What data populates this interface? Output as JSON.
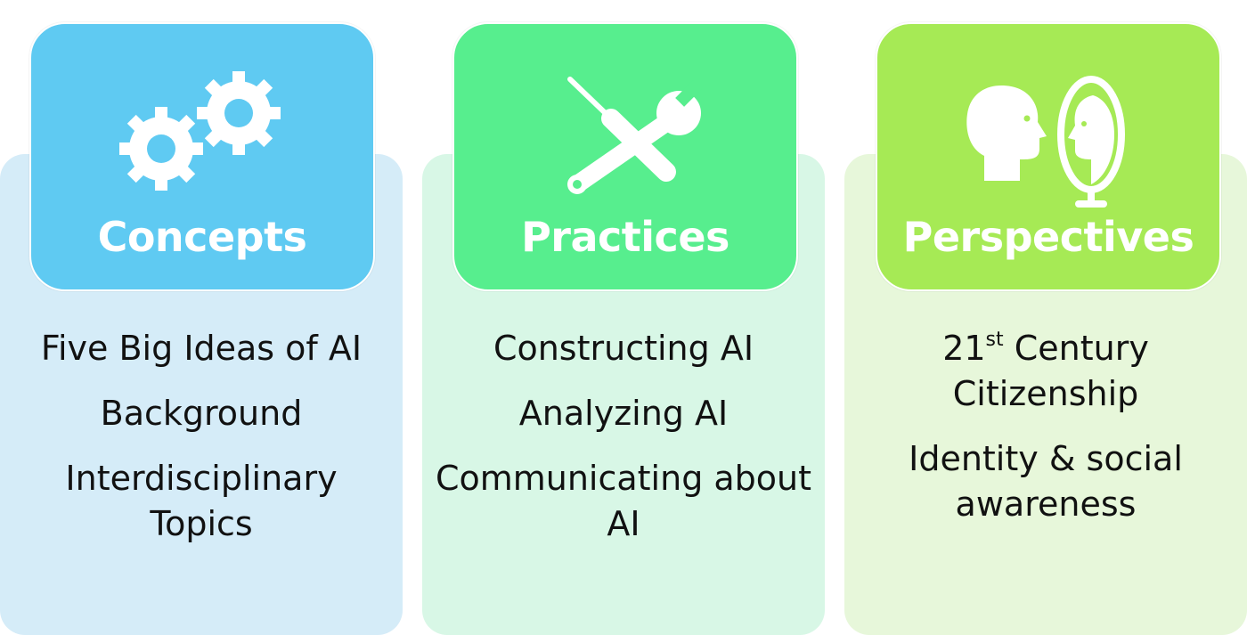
{
  "colors": {
    "concepts_header": "#5fcaf2",
    "concepts_bg": "#d5ecf8",
    "practices_header": "#57ee8e",
    "practices_bg": "#d8f7e6",
    "perspectives_header": "#a6ea55",
    "perspectives_bg": "#e7f7da"
  },
  "columns": [
    {
      "title": "Concepts",
      "icon": "gears-icon",
      "items": [
        {
          "lines": [
            "Five Big Ideas of AI"
          ]
        },
        {
          "lines": [
            "Background"
          ]
        },
        {
          "lines": [
            "Interdisciplinary",
            "Topics"
          ]
        }
      ]
    },
    {
      "title": "Practices",
      "icon": "tools-icon",
      "items": [
        {
          "lines": [
            "Constructing AI"
          ]
        },
        {
          "lines": [
            "Analyzing AI"
          ]
        },
        {
          "lines": [
            "Communicating about",
            "AI"
          ]
        }
      ]
    },
    {
      "title": "Perspectives",
      "icon": "mirror-head-icon",
      "items": [
        {
          "line1_num": "21",
          "line1_sup": "st",
          "line1_rest": " Century",
          "line2": "Citizenship"
        },
        {
          "lines": [
            "Identity & social",
            "awareness"
          ]
        }
      ]
    }
  ]
}
